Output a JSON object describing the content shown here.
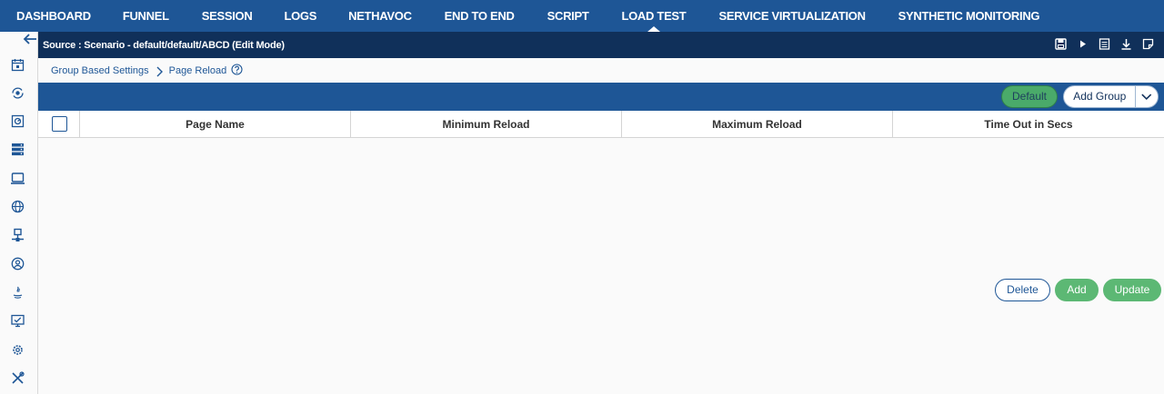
{
  "nav": {
    "tabs": [
      {
        "label": "DASHBOARD"
      },
      {
        "label": "FUNNEL"
      },
      {
        "label": "SESSION"
      },
      {
        "label": "LOGS"
      },
      {
        "label": "NETHAVOC"
      },
      {
        "label": "END TO END"
      },
      {
        "label": "SCRIPT"
      },
      {
        "label": "LOAD TEST",
        "active": true
      },
      {
        "label": "SERVICE VIRTUALIZATION"
      },
      {
        "label": "SYNTHETIC MONITORING"
      }
    ]
  },
  "source": {
    "text": "Source : Scenario - default/default/ABCD (Edit Mode)",
    "tools": [
      "save-icon",
      "play-icon",
      "list-icon",
      "download-icon",
      "note-icon"
    ]
  },
  "sidebar": {
    "icons": [
      "back-arrow-icon",
      "calendar-icon",
      "eye-refresh-icon",
      "monitor-gauge-icon",
      "server-stack-icon",
      "laptop-icon",
      "globe-icon",
      "network-node-icon",
      "user-circle-icon",
      "java-icon",
      "monitor-check-icon",
      "settings-cloud-icon",
      "tools-icon"
    ]
  },
  "breadcrumb": {
    "items": [
      "Group Based Settings",
      "Page Reload"
    ]
  },
  "toolbar": {
    "default_label": "Default",
    "add_group_label": "Add Group"
  },
  "table": {
    "columns": [
      "Page Name",
      "Minimum Reload",
      "Maximum Reload",
      "Time Out in Secs"
    ],
    "rows": []
  },
  "actions": {
    "delete_label": "Delete",
    "add_label": "Add",
    "update_label": "Update"
  },
  "colors": {
    "nav_bg": "#1e5696",
    "source_bg": "#10305a",
    "success": "#5cb874"
  }
}
